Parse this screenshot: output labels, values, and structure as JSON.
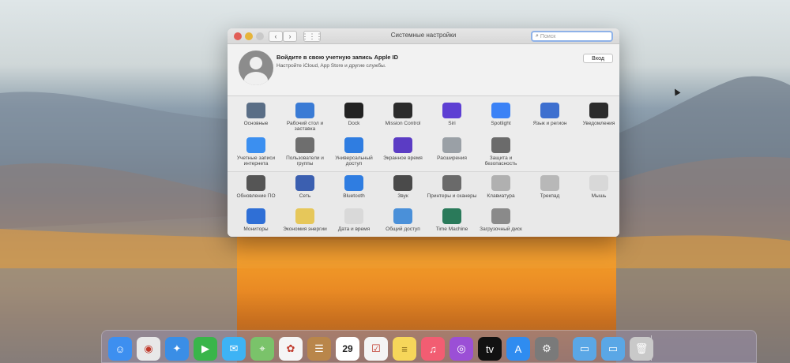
{
  "window": {
    "title": "Системные настройки",
    "search_placeholder": "Поиск",
    "nav_back": "‹",
    "nav_forward": "›",
    "grid_glyph": "⋮⋮⋮"
  },
  "apple_id": {
    "title": "Войдите в свою учетную запись Apple ID",
    "subtitle": "Настройте iCloud, App Store и другие службы.",
    "login_label": "Вход"
  },
  "prefs_row1": [
    {
      "label": "Основные",
      "icon": "general-icon",
      "color": "#5a6e86"
    },
    {
      "label": "Рабочий стол и заставка",
      "icon": "desktop-icon",
      "color": "#3a7bd5"
    },
    {
      "label": "Dock",
      "icon": "dock-icon",
      "color": "#222222"
    },
    {
      "label": "Mission Control",
      "icon": "mission-control-icon",
      "color": "#2b2b2b"
    },
    {
      "label": "Siri",
      "icon": "siri-icon",
      "color": "#5d3fd3"
    },
    {
      "label": "Spotlight",
      "icon": "spotlight-icon",
      "color": "#3b82f6"
    },
    {
      "label": "Язык и регион",
      "icon": "language-icon",
      "color": "#3d6fcf"
    },
    {
      "label": "Уведомления",
      "icon": "notifications-icon",
      "color": "#2c2c2c"
    }
  ],
  "prefs_row2": [
    {
      "label": "Учетные записи интернета",
      "icon": "internet-accounts-icon",
      "color": "#3b8ff0"
    },
    {
      "label": "Пользователи и группы",
      "icon": "users-icon",
      "color": "#6e6e6e"
    },
    {
      "label": "Универсальный доступ",
      "icon": "accessibility-icon",
      "color": "#2f7de1"
    },
    {
      "label": "Экранное время",
      "icon": "screen-time-icon",
      "color": "#5b3cc4"
    },
    {
      "label": "Расширения",
      "icon": "extensions-icon",
      "color": "#9aa0a6"
    },
    {
      "label": "Защита и безопасность",
      "icon": "security-icon",
      "color": "#6b6b6b"
    }
  ],
  "prefs_row3": [
    {
      "label": "Обновление ПО",
      "icon": "software-update-icon",
      "color": "#555555"
    },
    {
      "label": "Сеть",
      "icon": "network-icon",
      "color": "#3b5fb0"
    },
    {
      "label": "Bluetooth",
      "icon": "bluetooth-icon",
      "color": "#2f7de1"
    },
    {
      "label": "Звук",
      "icon": "sound-icon",
      "color": "#4a4a4a"
    },
    {
      "label": "Принтеры и сканеры",
      "icon": "printer-icon",
      "color": "#6a6a6a"
    },
    {
      "label": "Клавиатура",
      "icon": "keyboard-icon",
      "color": "#b0b0b0"
    },
    {
      "label": "Трекпад",
      "icon": "trackpad-icon",
      "color": "#b8b8b8"
    },
    {
      "label": "Мышь",
      "icon": "mouse-icon",
      "color": "#d8d8d8"
    }
  ],
  "prefs_row4": [
    {
      "label": "Мониторы",
      "icon": "displays-icon",
      "color": "#2f6fd6"
    },
    {
      "label": "Экономия энергии",
      "icon": "energy-saver-icon",
      "color": "#e6c75a"
    },
    {
      "label": "Дата и время",
      "icon": "date-time-icon",
      "color": "#d9d9d9"
    },
    {
      "label": "Общий доступ",
      "icon": "sharing-icon",
      "color": "#4a90d9"
    },
    {
      "label": "Time Machine",
      "icon": "time-machine-icon",
      "color": "#2a7a5a"
    },
    {
      "label": "Загрузочный диск",
      "icon": "startup-disk-icon",
      "color": "#8a8a8a"
    }
  ],
  "dock": [
    {
      "name": "finder-icon",
      "color": "#3d8ff0",
      "glyph": "☺"
    },
    {
      "name": "chrome-icon",
      "color": "#e8e8e8",
      "glyph": "◉"
    },
    {
      "name": "safari-icon",
      "color": "#3a8ee6",
      "glyph": "✦"
    },
    {
      "name": "facetime-icon",
      "color": "#39b54a",
      "glyph": "▶"
    },
    {
      "name": "messages-icon",
      "color": "#3db3f5",
      "glyph": "✉"
    },
    {
      "name": "maps-icon",
      "color": "#7ac36a",
      "glyph": "⌖"
    },
    {
      "name": "photos-icon",
      "color": "#f5f5f5",
      "glyph": "✿"
    },
    {
      "name": "contacts-icon",
      "color": "#b9864a",
      "glyph": "☰"
    },
    {
      "name": "calendar-icon",
      "color": "#ffffff",
      "glyph": "29"
    },
    {
      "name": "reminders-icon",
      "color": "#f4f4f4",
      "glyph": "☑"
    },
    {
      "name": "notes-icon",
      "color": "#f6d65a",
      "glyph": "≡"
    },
    {
      "name": "music-icon",
      "color": "#f25d72",
      "glyph": "♫"
    },
    {
      "name": "podcasts-icon",
      "color": "#9b4fd6",
      "glyph": "◎"
    },
    {
      "name": "apple-tv-icon",
      "color": "#111111",
      "glyph": "tv"
    },
    {
      "name": "app-store-icon",
      "color": "#2f8cf0",
      "glyph": "A"
    },
    {
      "name": "system-preferences-icon",
      "color": "#7a7a7a",
      "glyph": "⚙"
    },
    {
      "name": "applications-folder-icon",
      "color": "#5aa7e6",
      "glyph": "▭"
    },
    {
      "name": "downloads-folder-icon",
      "color": "#5aa7e6",
      "glyph": "▭"
    },
    {
      "name": "trash-icon",
      "color": "#c9c9c9",
      "glyph": "🗑"
    }
  ]
}
